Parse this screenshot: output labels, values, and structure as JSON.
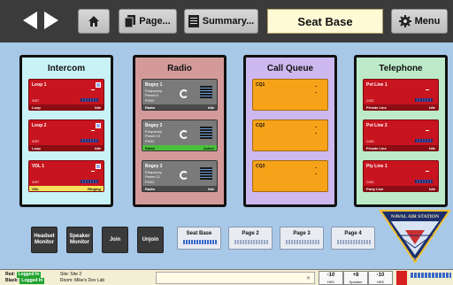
{
  "toolbar": {
    "page_label": "Page...",
    "summary_label": "Summary...",
    "title": "Seat Base",
    "menu_label": "Menu"
  },
  "panels": [
    {
      "title": "Intercom",
      "color": "#c9f2f7",
      "cards": [
        {
          "name": "Loop 1",
          "id": "S/07",
          "label": "Loop",
          "state": "Idle"
        },
        {
          "name": "Loop 2",
          "id": "S/07",
          "label": "Loop",
          "state": "Idle"
        },
        {
          "name": "VDL 1",
          "id": "S/07",
          "label": "VDL",
          "state": "Ringing"
        }
      ]
    },
    {
      "title": "Radio",
      "color": "#d49a9a",
      "cards": [
        {
          "name": "Bogey 1",
          "line1": "Frequency",
          "line2": "Preset 5",
          "id": "P/022",
          "label": "Radio",
          "state": "Idle"
        },
        {
          "name": "Bogey 2",
          "line1": "Frequency",
          "line2": "Preset 19",
          "id": "P/022",
          "label": "Radio",
          "state": "Active"
        },
        {
          "name": "Bogey 3",
          "line1": "Frequency",
          "line2": "Preset 11",
          "id": "P/022",
          "label": "Radio",
          "state": "Idle"
        }
      ]
    },
    {
      "title": "Call Queue",
      "color": "#cdb8ef",
      "cards": [
        {
          "name": "CQ1"
        },
        {
          "name": "CQ2"
        },
        {
          "name": "CQ3"
        }
      ]
    },
    {
      "title": "Telephone",
      "color": "#bdebc9",
      "cards": [
        {
          "name": "Pvt Line 1",
          "id": "C/02",
          "label": "Private Line",
          "state": "Idle"
        },
        {
          "name": "Pvt Line 2",
          "id": "C/03",
          "label": "Private Line",
          "state": "Idle"
        },
        {
          "name": "Pty Line 1",
          "id": "C/02",
          "label": "Party Line",
          "state": "Idle"
        }
      ]
    }
  ],
  "lower_buttons": {
    "headset_monitor": "Headset Monitor",
    "speaker_monitor": "Speaker Monitor",
    "join": "Join",
    "unjoin": "Unjoin"
  },
  "pages": [
    "Seat Base",
    "Page 2",
    "Page 3",
    "Page 4"
  ],
  "seal": {
    "text": "NAVAL AIR STATION",
    "year": "1943"
  },
  "status": {
    "red_label": "Red:",
    "red_state": "Logged In",
    "black_label": "Black:",
    "black_state": "Logged In",
    "site": "Site: Site 2",
    "room": "Room: Mike's Dev Lab",
    "vol1_value": "-10",
    "vol1_label": "HR1",
    "vol2_value": "+8",
    "vol2_label": "Speaker",
    "vol3_value": "-10",
    "vol3_label": "HR2"
  },
  "colors": {
    "background": "#a8c8e8",
    "toolbar": "#3b3b3b",
    "title_box": "#fff9d6",
    "red_card": "#c8141e",
    "gray_card": "#7a7a7a",
    "orange_card": "#f6a31a",
    "active_green": "#49c13a",
    "logged_in": "#23a330"
  }
}
